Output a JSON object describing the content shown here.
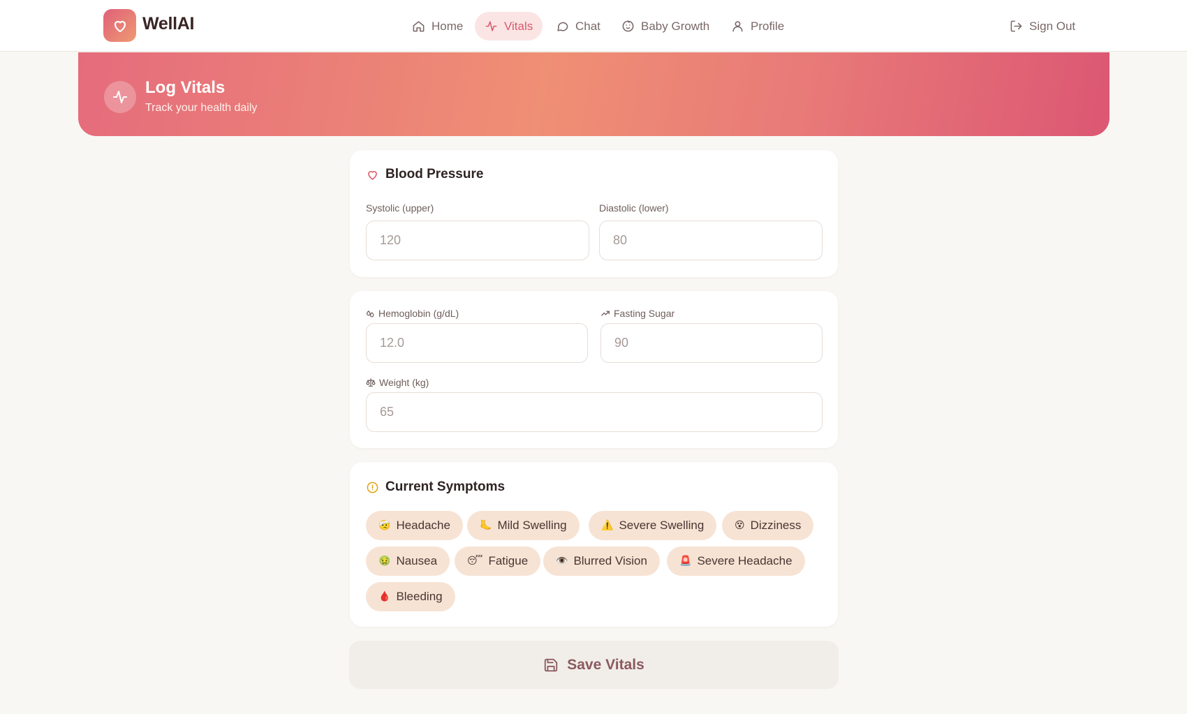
{
  "app": {
    "name": "WellAI"
  },
  "nav": {
    "items": [
      {
        "label": "Home",
        "icon": "home-icon"
      },
      {
        "label": "Vitals",
        "icon": "activity-icon",
        "active": true
      },
      {
        "label": "Chat",
        "icon": "chat-icon"
      },
      {
        "label": "Baby Growth",
        "icon": "baby-icon"
      },
      {
        "label": "Profile",
        "icon": "user-icon"
      }
    ],
    "sign_out": "Sign Out"
  },
  "hero": {
    "title": "Log Vitals",
    "subtitle": "Track your health daily"
  },
  "blood_pressure": {
    "title": "Blood Pressure",
    "systolic_label": "Systolic (upper)",
    "systolic_placeholder": "120",
    "diastolic_label": "Diastolic (lower)",
    "diastolic_placeholder": "80"
  },
  "metrics": {
    "hemoglobin_label": "Hemoglobin (g/dL)",
    "hemoglobin_placeholder": "12.0",
    "sugar_label": "Fasting Sugar",
    "sugar_placeholder": "90",
    "weight_label": "Weight (kg)",
    "weight_placeholder": "65"
  },
  "symptoms": {
    "title": "Current Symptoms",
    "items": [
      {
        "label": "Headache",
        "emoji": "🤕"
      },
      {
        "label": "Mild Swelling",
        "emoji": "🦶"
      },
      {
        "label": "Severe Swelling",
        "emoji": "⚠️"
      },
      {
        "label": "Dizziness",
        "emoji": "😵"
      },
      {
        "label": "Nausea",
        "emoji": "🤢"
      },
      {
        "label": "Fatigue",
        "emoji": "😴"
      },
      {
        "label": "Blurred Vision",
        "emoji": "👁️"
      },
      {
        "label": "Severe Headache",
        "emoji": "🚨"
      },
      {
        "label": "Bleeding",
        "emoji": "🩸"
      }
    ]
  },
  "save_label": "Save Vitals",
  "colors": {
    "accent": "#d65a6e",
    "chip_bg": "#f7e3d4",
    "page_bg": "#f9f7f3"
  }
}
